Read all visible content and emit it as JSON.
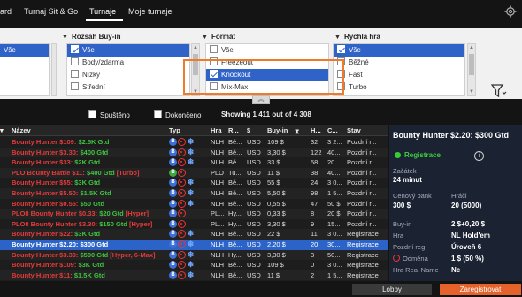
{
  "nav": {
    "tabs": [
      {
        "label": "ard"
      },
      {
        "label": "Turnaj Sit & Go"
      },
      {
        "label": "Turnaje"
      },
      {
        "label": "Moje turnaje"
      }
    ]
  },
  "filters": {
    "buyin": {
      "title": "Rozsah Buy-in",
      "items": [
        "Vše",
        "Body/zdarma",
        "Nízký",
        "Střední"
      ]
    },
    "left_partial": {
      "items": [
        "Vše"
      ]
    },
    "format": {
      "title": "Formát",
      "items": [
        "Vše",
        "Freezeout",
        "Knockout",
        "Mix-Max"
      ]
    },
    "rychla": {
      "title": "Rychlá hra",
      "items": [
        "Vše",
        "Běžné",
        "Fast",
        "Turbo"
      ]
    }
  },
  "status": {
    "spusteno": "Spuštěno",
    "dokonceno": "Dokončeno",
    "showing": "Showing 1 411 out of 4 308"
  },
  "table": {
    "headers": [
      "Název",
      "Typ",
      "Hra",
      "R...",
      "$",
      "Buy-in",
      "",
      "H...",
      "C...",
      "Stav"
    ],
    "rows": [
      {
        "name": "Bounty Hunter $109: ",
        "gtd": "$2.5K Gtd",
        "extra": "",
        "icons": [
          "b",
          "t",
          "s"
        ],
        "hra": "NLH",
        "r": "Bě...",
        "cur": "USD",
        "buyin": "109 $",
        "h": "32",
        "c": "3 2...",
        "stav": "Pozdní r..."
      },
      {
        "name": "Bounty Hunter $3.30: ",
        "gtd": "$400 Gtd",
        "extra": "",
        "icons": [
          "b",
          "t",
          "s"
        ],
        "hra": "NLH",
        "r": "Bě...",
        "cur": "USD",
        "buyin": "3,30 $",
        "h": "122",
        "c": "40...",
        "stav": "Pozdní r..."
      },
      {
        "name": "Bounty Hunter $33: ",
        "gtd": "$2K Gtd",
        "extra": "",
        "icons": [
          "b",
          "t",
          "s"
        ],
        "hra": "NLH",
        "r": "Bě...",
        "cur": "USD",
        "buyin": "33 $",
        "h": "58",
        "c": "20...",
        "stav": "Pozdní r..."
      },
      {
        "name": "PLO Bounty Battle $11: ",
        "gtd": "$400 Gtd",
        "extra": " [Turbo]",
        "icons": [
          "g",
          "t"
        ],
        "hra": "PLO",
        "r": "Tu...",
        "cur": "USD",
        "buyin": "11 $",
        "h": "38",
        "c": "40...",
        "stav": "Pozdní r..."
      },
      {
        "name": "Bounty Hunter $55: ",
        "gtd": "$3K Gtd",
        "extra": "",
        "icons": [
          "b",
          "t",
          "s"
        ],
        "hra": "NLH",
        "r": "Bě...",
        "cur": "USD",
        "buyin": "55 $",
        "h": "24",
        "c": "3 0...",
        "stav": "Pozdní r..."
      },
      {
        "name": "Bounty Hunter $5.50: ",
        "gtd": "$1.5K Gtd",
        "extra": "",
        "icons": [
          "b",
          "t",
          "s"
        ],
        "hra": "NLH",
        "r": "Bě...",
        "cur": "USD",
        "buyin": "5,50 $",
        "h": "98",
        "c": "1 5...",
        "stav": "Pozdní r..."
      },
      {
        "name": "Bounty Hunter $0.55: ",
        "gtd": "$50 Gtd",
        "extra": "",
        "icons": [
          "b",
          "t",
          "s"
        ],
        "hra": "NLH",
        "r": "Bě...",
        "cur": "USD",
        "buyin": "0,55 $",
        "h": "47",
        "c": "50 $",
        "stav": "Pozdní r..."
      },
      {
        "name": "PLO8 Bounty Hunter $0.33: ",
        "gtd": "$20 Gtd",
        "extra": " [Hyper]",
        "icons": [
          "b",
          "t"
        ],
        "hra": "PL...",
        "r": "Hy...",
        "cur": "USD",
        "buyin": "0,33 $",
        "h": "8",
        "c": "20 $",
        "stav": "Pozdní r..."
      },
      {
        "name": "PLO8 Bounty Hunter $3.30: ",
        "gtd": "$150 Gtd",
        "extra": " [Hyper]",
        "icons": [
          "b",
          "t"
        ],
        "hra": "PL...",
        "r": "Hy...",
        "cur": "USD",
        "buyin": "3,30 $",
        "h": "9",
        "c": "15...",
        "stav": "Pozdní r..."
      },
      {
        "name": "Bounty Hunter $22: ",
        "gtd": "$3K Gtd",
        "extra": "",
        "icons": [
          "b",
          "t",
          "s"
        ],
        "hra": "NLH",
        "r": "Bě...",
        "cur": "USD",
        "buyin": "22 $",
        "h": "11",
        "c": "3 0...",
        "stav": "Registrace"
      },
      {
        "name": "Bounty Hunter $2.20: ",
        "gtd": "$300 Gtd",
        "extra": "",
        "icons": [
          "b",
          "t",
          "s"
        ],
        "hra": "NLH",
        "r": "Bě...",
        "cur": "USD",
        "buyin": "2,20 $",
        "h": "20",
        "c": "30...",
        "stav": "Registrace",
        "selected": true
      },
      {
        "name": "Bounty Hunter $3.30: ",
        "gtd": "$500 Gtd",
        "extra": " [Hyper, 6-Max]",
        "icons": [
          "b",
          "t",
          "s"
        ],
        "hra": "NLH",
        "r": "Hy...",
        "cur": "USD",
        "buyin": "3,30 $",
        "h": "3",
        "c": "50...",
        "stav": "Registrace"
      },
      {
        "name": "Bounty Hunter $109: ",
        "gtd": "$3K Gtd",
        "extra": "",
        "icons": [
          "b",
          "t",
          "s"
        ],
        "hra": "NLH",
        "r": "Bě...",
        "cur": "USD",
        "buyin": "109 $",
        "h": "0",
        "c": "3 0...",
        "stav": "Registrace"
      },
      {
        "name": "Bounty Hunter $11: ",
        "gtd": "$1.5K Gtd",
        "extra": "",
        "icons": [
          "b",
          "t",
          "s"
        ],
        "hra": "NLH",
        "r": "Bě...",
        "cur": "USD",
        "buyin": "11 $",
        "h": "2",
        "c": "1 5...",
        "stav": "Registrace"
      }
    ]
  },
  "detail": {
    "title": "Bounty Hunter $2.20: $300 Gtd",
    "status": "Registrace",
    "info": "i",
    "zacatek_label": "Začátek",
    "zacatek_value": "24 minut",
    "bank_label": "Cenový bank",
    "bank_value": "300 $",
    "hraci_label": "Hráči",
    "hraci_value": "20 (5000)",
    "buyin_label": "Buy-in",
    "buyin_value": "2 $+0,20 $",
    "hra_label": "Hra",
    "hra_value": "NL Hold'em",
    "pozdni_label": "Pozdní reg",
    "pozdni_value": "Úroveň 6",
    "odmena_label": "Odměna",
    "odmena_value": "1 $ (50 %)",
    "realname_label": "Hra Real Name",
    "realname_value": "Ne"
  },
  "bottom": {
    "lobby": "Lobby",
    "register": "Zaregistrovat"
  },
  "colors": {
    "accent": "#2f63c8",
    "highlight_box": "#ef7b2a",
    "register_button": "#e5622a",
    "name_red": "#e73a3a",
    "gtd_green": "#3fc23f"
  }
}
